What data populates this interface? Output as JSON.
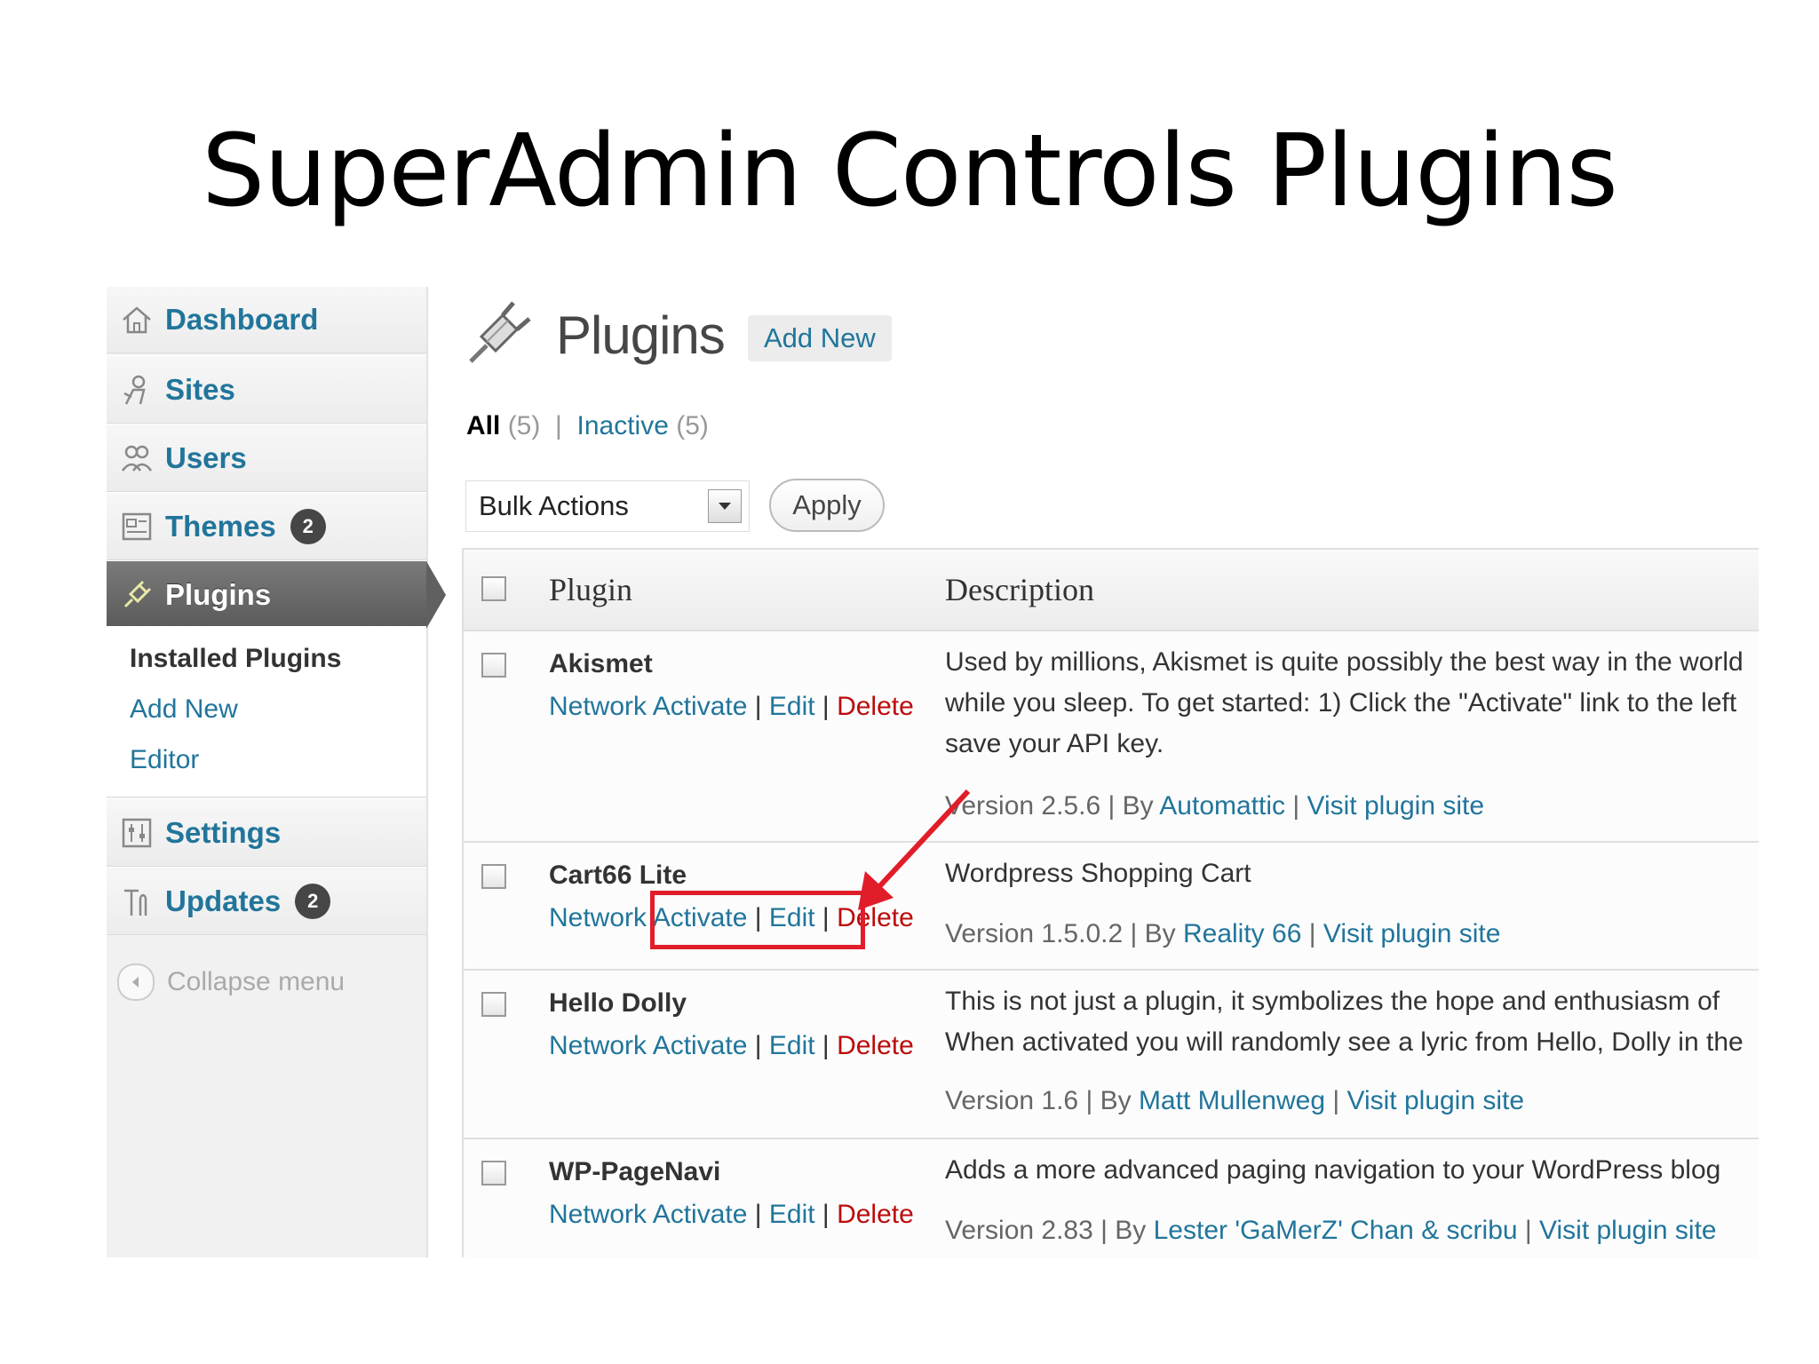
{
  "slide": {
    "title": "SuperAdmin Controls Plugins"
  },
  "sidebar": {
    "items": [
      {
        "label": "Dashboard",
        "icon": "home-icon"
      },
      {
        "label": "Sites",
        "icon": "sites-icon"
      },
      {
        "label": "Users",
        "icon": "users-icon"
      },
      {
        "label": "Themes",
        "icon": "themes-icon",
        "badge": "2"
      },
      {
        "label": "Plugins",
        "icon": "plugin-icon",
        "current": true
      },
      {
        "label": "Settings",
        "icon": "settings-icon"
      },
      {
        "label": "Updates",
        "icon": "updates-icon",
        "badge": "2"
      }
    ],
    "submenu": [
      {
        "label": "Installed Plugins",
        "active": true
      },
      {
        "label": "Add New"
      },
      {
        "label": "Editor"
      }
    ],
    "collapse_label": "Collapse menu"
  },
  "header": {
    "title": "Plugins",
    "add_new": "Add New"
  },
  "filters": {
    "all": "All",
    "all_count": "(5)",
    "separator": "|",
    "inactive": "Inactive",
    "inactive_count": "(5)"
  },
  "bulk": {
    "selected": "Bulk Actions",
    "apply": "Apply"
  },
  "table": {
    "columns": [
      "Plugin",
      "Description"
    ],
    "rows": [
      {
        "name": "Akismet",
        "actions": [
          "Network Activate",
          "Edit",
          "Delete"
        ],
        "description": [
          "Used by millions, Akismet is quite possibly the best way in the world",
          "while you sleep. To get started: 1) Click the \"Activate\" link to the left",
          "save your API key."
        ],
        "version": "Version 2.5.6",
        "by": "By",
        "author": "Automattic",
        "visit": "Visit plugin site"
      },
      {
        "name": "Cart66 Lite",
        "actions": [
          "Network Activate",
          "Edit",
          "Delete"
        ],
        "description": [
          "Wordpress Shopping Cart"
        ],
        "version": "Version 1.5.0.2",
        "by": "By",
        "author": "Reality 66",
        "visit": "Visit plugin site"
      },
      {
        "name": "Hello Dolly",
        "actions": [
          "Network Activate",
          "Edit",
          "Delete"
        ],
        "description": [
          "This is not just a plugin, it symbolizes the hope and enthusiasm of",
          "When activated you will randomly see a lyric from Hello, Dolly in the"
        ],
        "version": "Version 1.6",
        "by": "By",
        "author": "Matt Mullenweg",
        "visit": "Visit plugin site"
      },
      {
        "name": "WP-PageNavi",
        "actions": [
          "Network Activate",
          "Edit",
          "Delete"
        ],
        "description": [
          "Adds a more advanced paging navigation to your WordPress blog"
        ],
        "version": "Version 2.83",
        "by": "By",
        "author": "Lester 'GaMerZ' Chan & scribu",
        "visit": "Visit plugin site"
      }
    ]
  },
  "colors": {
    "link": "#21759b",
    "delete": "#bc0b0b",
    "highlight": "#e11d2a",
    "menu_current": "#606060"
  }
}
